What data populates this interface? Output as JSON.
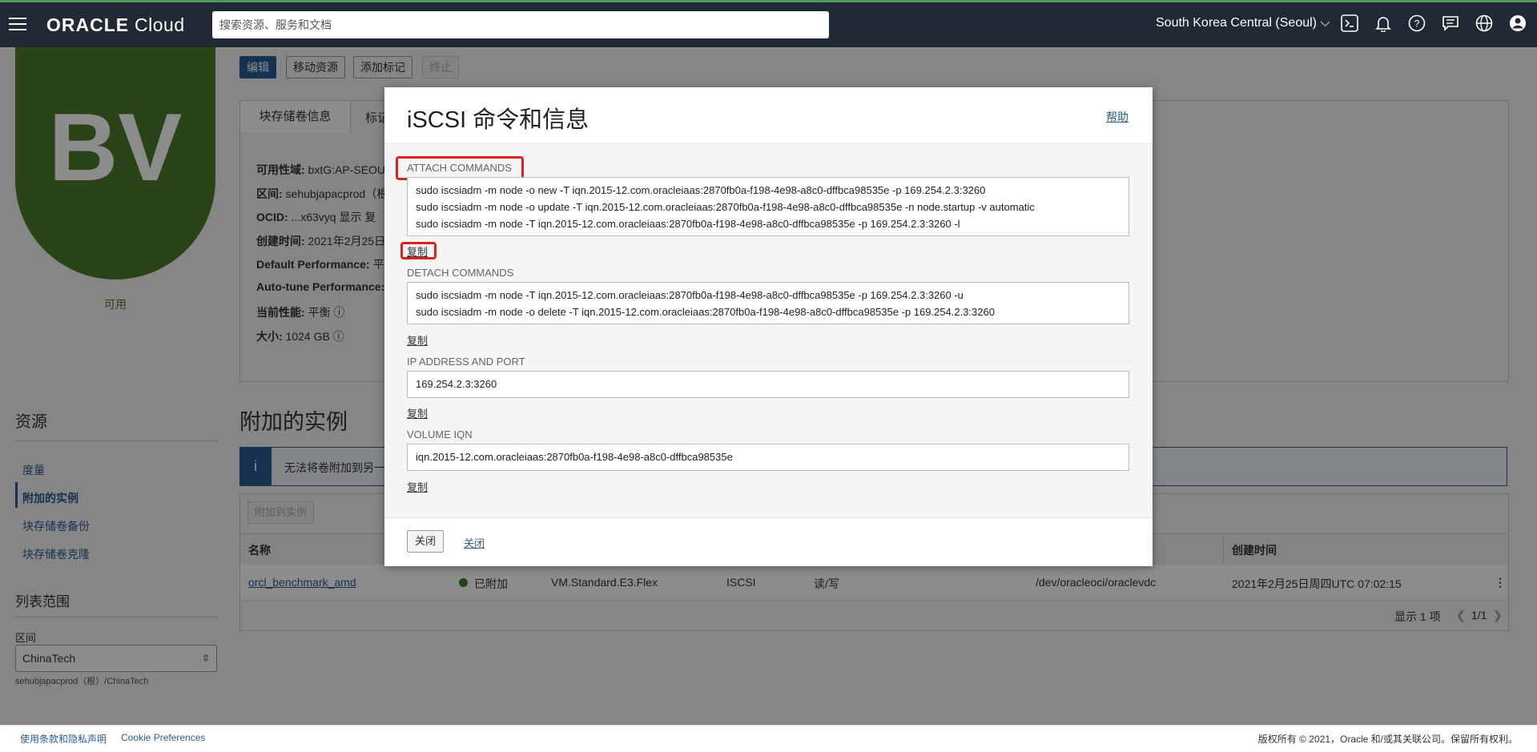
{
  "header": {
    "brand_bold": "ORACLE",
    "brand_light": " Cloud",
    "search_placeholder": "搜索资源、服务和文档",
    "region": "South Korea Central (Seoul)",
    "region_chevron": "⌵"
  },
  "volume": {
    "avatar_text": "BV",
    "status": "可用",
    "toolbar": {
      "edit": "编辑",
      "move": "移动资源",
      "add_tag": "添加标记",
      "terminate": "终止"
    },
    "tabs": [
      "块存储卷信息",
      "标记"
    ],
    "fields": [
      {
        "label": "可用性域:",
        "value": " bxtG:AP-SEOUL"
      },
      {
        "label": "区间:",
        "value": " sehubjapacprod（根"
      },
      {
        "label": "OCID:",
        "value": " ...x63vyq  显示  复"
      },
      {
        "label": "创建时间:",
        "value": " 2021年2月25日"
      },
      {
        "label": "Default Performance:",
        "value": " 平"
      },
      {
        "label": "Auto-tune Performance:",
        "value": ""
      },
      {
        "label": "当前性能:",
        "value": " 平衡 ⓘ"
      },
      {
        "label": "大小:",
        "value": " 1024 GB ⓘ"
      }
    ]
  },
  "sidebar": {
    "resources_title": "资源",
    "items": [
      "度量",
      "附加的实例",
      "块存储卷备份",
      "块存储卷克隆"
    ],
    "scope_title": "列表范围",
    "zone_label": "区间",
    "zone_value": "ChinaTech",
    "zone_path": "sehubjapacprod（根）/ChinaTech"
  },
  "attached": {
    "title": "附加的实例",
    "alert_icon": "i",
    "alert_text": "无法将卷附加到另一",
    "attach_button": "附加到实例",
    "columns": [
      "名称",
      "创建时间"
    ],
    "row": {
      "name": "orcl_benchmark_amd",
      "state": "已附加",
      "shape": "VM.Standard.E3.Flex",
      "type": "ISCSI",
      "access": "读/写",
      "device": "/dev/oracleoci/oraclevdc",
      "created": "2021年2月25日周四UTC 07:02:15",
      "menu": "⋮"
    },
    "pager_text": "显示 1 项",
    "pager_pages": "1/1"
  },
  "modal": {
    "title": "iSCSI 命令和信息",
    "help": "帮助",
    "attach_label": "ATTACH COMMANDS",
    "attach_cmds": [
      "sudo iscsiadm -m node -o new -T iqn.2015-12.com.oracleiaas:2870fb0a-f198-4e98-a8c0-dffbca98535e -p 169.254.2.3:3260",
      "sudo iscsiadm -m node -o update -T iqn.2015-12.com.oracleiaas:2870fb0a-f198-4e98-a8c0-dffbca98535e -n node.startup -v automatic",
      "sudo iscsiadm -m node -T iqn.2015-12.com.oracleiaas:2870fb0a-f198-4e98-a8c0-dffbca98535e -p 169.254.2.3:3260 -l"
    ],
    "detach_label": "DETACH COMMANDS",
    "detach_cmds": [
      "sudo iscsiadm -m node -T iqn.2015-12.com.oracleiaas:2870fb0a-f198-4e98-a8c0-dffbca98535e -p 169.254.2.3:3260 -u",
      "sudo iscsiadm -m node -o delete -T iqn.2015-12.com.oracleiaas:2870fb0a-f198-4e98-a8c0-dffbca98535e -p 169.254.2.3:3260"
    ],
    "ip_label": "IP ADDRESS AND PORT",
    "ip_value": "169.254.2.3:3260",
    "iqn_label": "VOLUME IQN",
    "iqn_value": "iqn.2015-12.com.oracleiaas:2870fb0a-f198-4e98-a8c0-dffbca98535e",
    "copy": "复制",
    "close_button": "关闭",
    "close_link": "关闭"
  },
  "footer": {
    "terms": "使用条款和隐私声明",
    "cookie": "Cookie Preferences",
    "copyright": "版权所有 © 2021，Oracle 和/或其关联公司。保留所有权利。"
  }
}
